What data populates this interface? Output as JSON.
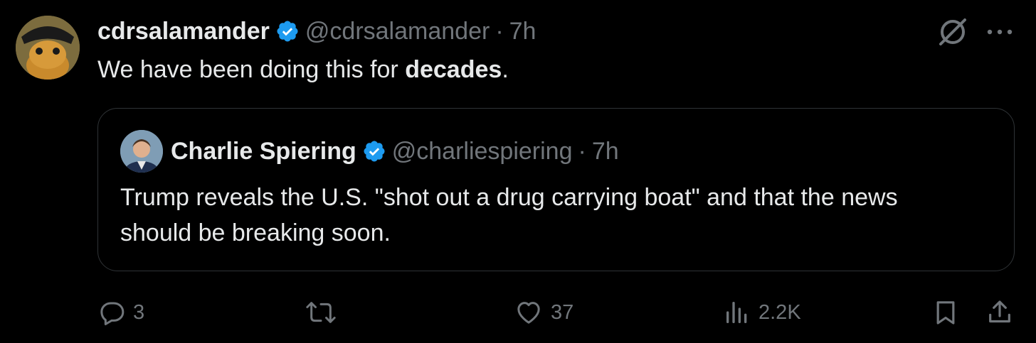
{
  "tweet": {
    "display_name": "cdrsalamander",
    "handle": "@cdrsalamander",
    "separator": "·",
    "time": "7h",
    "text_prefix": "We have been doing this for ",
    "text_bold": "decades",
    "text_suffix": "."
  },
  "quoted_tweet": {
    "display_name": "Charlie Spiering",
    "handle": "@charliespiering",
    "separator": "·",
    "time": "7h",
    "text": "Trump reveals the U.S. \"shot out a drug carrying boat\" and that the news should be breaking soon."
  },
  "actions": {
    "replies": "3",
    "reposts": "",
    "likes": "37",
    "views": "2.2K"
  },
  "colors": {
    "background": "#000000",
    "text": "#e7e9ea",
    "secondary": "#71767b",
    "verified": "#1d9bf0",
    "border": "#2f3336"
  },
  "icons": [
    "grok-icon",
    "more-icon",
    "reply-icon",
    "repost-icon",
    "like-icon",
    "views-icon",
    "bookmark-icon",
    "share-icon",
    "verified-badge-icon"
  ]
}
